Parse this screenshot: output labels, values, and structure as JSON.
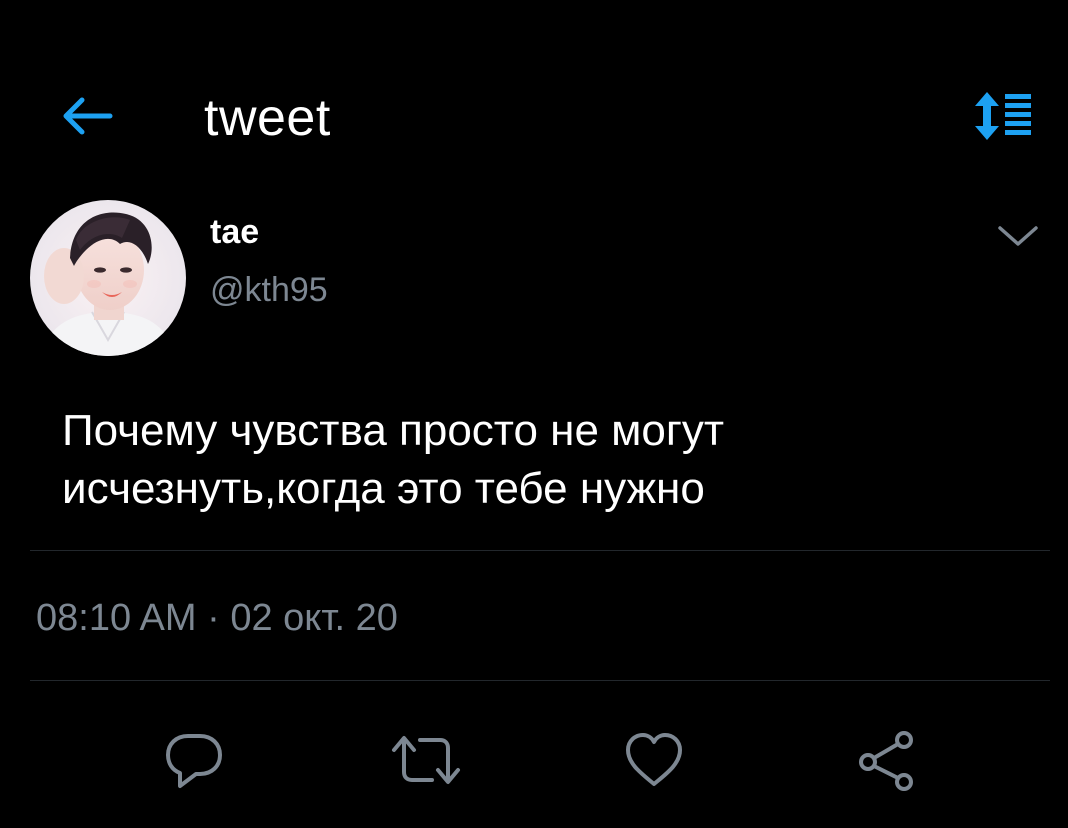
{
  "header": {
    "title": "tweet",
    "back_icon": "arrow-left-icon",
    "sort_icon": "sort-list-icon",
    "accent_color": "#1da1f2"
  },
  "tweet": {
    "author": {
      "name": "tae",
      "handle": "@kth95"
    },
    "text": "Почему чувства просто не могут\nисчезнуть,когда это тебе нужно",
    "timestamp": "08:10 AM · 02 окт. 20",
    "more_icon": "chevron-down-icon"
  },
  "actions": [
    {
      "icon": "reply-icon"
    },
    {
      "icon": "retweet-icon"
    },
    {
      "icon": "like-heart-icon"
    },
    {
      "icon": "share-icon"
    }
  ],
  "colors": {
    "background": "#000000",
    "text_primary": "#ffffff",
    "text_secondary": "#7d8792",
    "divider": "#22272c",
    "icon": "#7d8792"
  }
}
